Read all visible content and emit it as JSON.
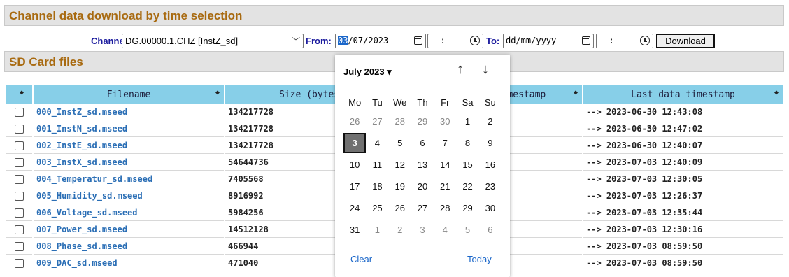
{
  "section1": {
    "title": "Channel data download by time selection"
  },
  "toolbar": {
    "channel_label": "Channel:",
    "channel_value": "DG.00000.1.CHZ [InstZ_sd]",
    "from_label": "From:",
    "from_date_day": "03",
    "from_date_rest": "/07/2023",
    "from_time": "--:--",
    "to_label": "To:",
    "to_date": "dd/mm/yyyy",
    "to_time": "--:--",
    "download_label": "Download"
  },
  "section2": {
    "title": "SD Card files"
  },
  "table": {
    "headers": {
      "filename": "Filename",
      "size": "Size (bytes)",
      "first": "First data timestamp",
      "last": "Last data timestamp"
    },
    "rows": [
      {
        "filename": "000_InstZ_sd.mseed",
        "size": "134217728",
        "last": "--> 2023-06-30 12:43:08"
      },
      {
        "filename": "001_InstN_sd.mseed",
        "size": "134217728",
        "last": "--> 2023-06-30 12:47:02"
      },
      {
        "filename": "002_InstE_sd.mseed",
        "size": "134217728",
        "last": "--> 2023-06-30 12:40:07"
      },
      {
        "filename": "003_InstX_sd.mseed",
        "size": "54644736",
        "last": "--> 2023-07-03 12:40:09"
      },
      {
        "filename": "004_Temperatur_sd.mseed",
        "size": "7405568",
        "last": "--> 2023-07-03 12:30:05"
      },
      {
        "filename": "005_Humidity_sd.mseed",
        "size": "8916992",
        "last": "--> 2023-07-03 12:26:37"
      },
      {
        "filename": "006_Voltage_sd.mseed",
        "size": "5984256",
        "last": "--> 2023-07-03 12:35:44"
      },
      {
        "filename": "007_Power_sd.mseed",
        "size": "14512128",
        "last": "--> 2023-07-03 12:30:16"
      },
      {
        "filename": "008_Phase_sd.mseed",
        "size": "466944",
        "last": "--> 2023-07-03 08:59:50"
      },
      {
        "filename": "009_DAC_sd.mseed",
        "size": "471040",
        "last": "--> 2023-07-03 08:59:50"
      }
    ]
  },
  "calendar": {
    "month": "July 2023 ▾",
    "prev": "↑",
    "next": "↓",
    "dow": [
      "Mo",
      "Tu",
      "We",
      "Th",
      "Fr",
      "Sa",
      "Su"
    ],
    "weeks": [
      [
        "26",
        "27",
        "28",
        "29",
        "30",
        "1",
        "2"
      ],
      [
        "3",
        "4",
        "5",
        "6",
        "7",
        "8",
        "9"
      ],
      [
        "10",
        "11",
        "12",
        "13",
        "14",
        "15",
        "16"
      ],
      [
        "17",
        "18",
        "19",
        "20",
        "21",
        "22",
        "23"
      ],
      [
        "24",
        "25",
        "26",
        "27",
        "28",
        "29",
        "30"
      ],
      [
        "31",
        "1",
        "2",
        "3",
        "4",
        "5",
        "6"
      ]
    ],
    "clear": "Clear",
    "today": "Today"
  }
}
